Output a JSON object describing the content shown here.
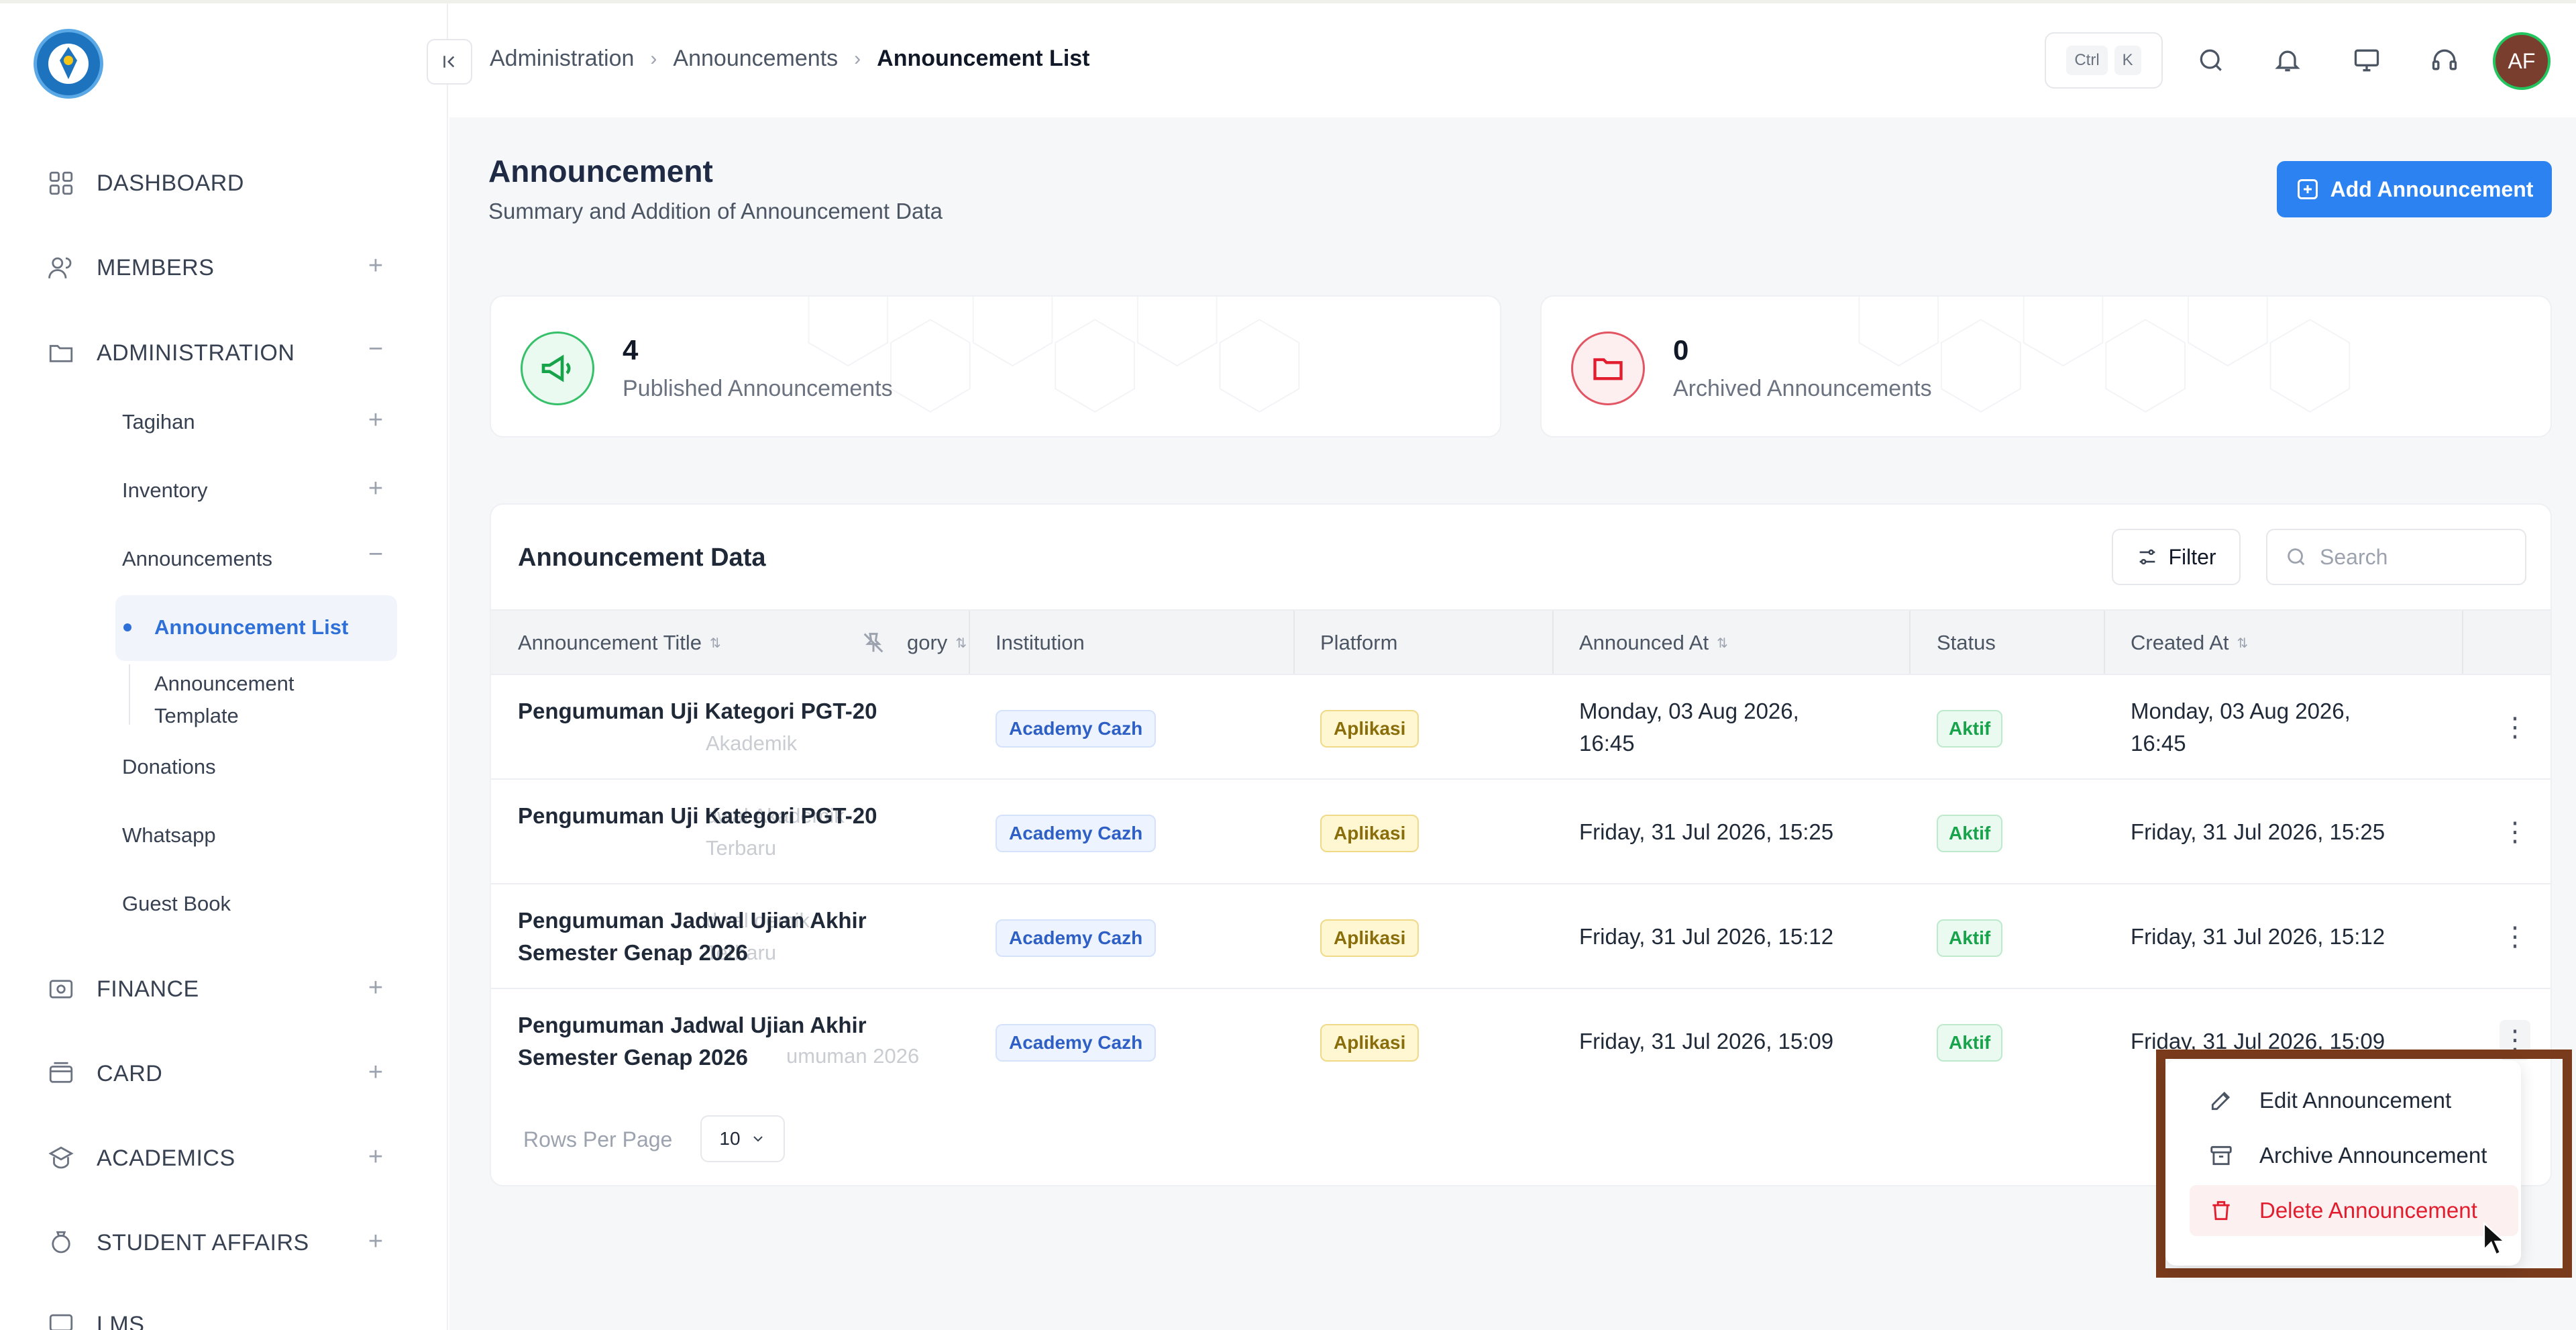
{
  "sidebar": {
    "dashboard": "DASHBOARD",
    "members": "MEMBERS",
    "administration": "ADMINISTRATION",
    "sub_items": {
      "tagihan": "Tagihan",
      "inventory": "Inventory",
      "announcements": "Announcements",
      "announcement_list": "Announcement List",
      "announcement_template": "Announcement Template",
      "donations": "Donations",
      "whatsapp": "Whatsapp",
      "guest_book": "Guest Book"
    },
    "finance": "FINANCE",
    "card": "CARD",
    "academics": "ACADEMICS",
    "student_affairs": "STUDENT AFFAIRS",
    "lms": "LMS"
  },
  "topbar": {
    "breadcrumb": [
      "Administration",
      "Announcements",
      "Announcement List"
    ],
    "kbd": [
      "Ctrl",
      "K"
    ],
    "avatar": "AF"
  },
  "page": {
    "title": "Announcement",
    "subtitle": "Summary and Addition of Announcement Data",
    "add_button": "Add Announcement"
  },
  "stats": {
    "published": {
      "count": "4",
      "label": "Published Announcements"
    },
    "archived": {
      "count": "0",
      "label": "Archived Announcements"
    }
  },
  "table": {
    "title": "Announcement Data",
    "filter": "Filter",
    "search_placeholder": "Search",
    "columns": {
      "title": "Announcement Title",
      "category": "gory",
      "institution": "Institution",
      "platform": "Platform",
      "announced_at": "Announced At",
      "status": "Status",
      "created_at": "Created At"
    },
    "rows": [
      {
        "title": "Pengumuman Uji Kategori PGT-20",
        "ghost": "Akademik",
        "institution": "Academy Cazh",
        "platform": "Aplikasi",
        "announced_at": "Monday, 03 Aug 2026, 16:45",
        "status": "Aktif",
        "created_at": "Monday, 03 Aug 2026, 16:45"
      },
      {
        "title": "Pengumuman Uji Kategori PGT-20",
        "ghost": "dwal Akademik Terbaru",
        "institution": "Academy Cazh",
        "platform": "Aplikasi",
        "announced_at": "Friday, 31 Jul 2026, 15:25",
        "status": "Aktif",
        "created_at": "Friday, 31 Jul 2026, 15:25"
      },
      {
        "title": "Pengumuman Jadwal Ujian Akhir Semester Genap 2026",
        "ghost": "dwal demik Terbaru",
        "institution": "Academy Cazh",
        "platform": "Aplikasi",
        "announced_at": "Friday, 31 Jul 2026, 15:12",
        "status": "Aktif",
        "created_at": "Friday, 31 Jul 2026, 15:12"
      },
      {
        "title": "Pengumuman Jadwal Ujian Akhir Semester Genap 2026",
        "ghost": "umuman 2026",
        "institution": "Academy Cazh",
        "platform": "Aplikasi",
        "announced_at": "Friday, 31 Jul 2026, 15:09",
        "status": "Aktif",
        "created_at": "Friday, 31 Jul 2026, 15:09"
      }
    ],
    "rows_per_page_label": "Rows Per Page",
    "rows_per_page_value": "10"
  },
  "menu": {
    "edit": "Edit Announcement",
    "archive": "Archive Announcement",
    "delete": "Delete Announcement"
  },
  "colors": {
    "primary": "#2b82f0",
    "success": "#17a34a",
    "danger": "#e11d2e",
    "highlight_frame": "#7a3b1d"
  }
}
